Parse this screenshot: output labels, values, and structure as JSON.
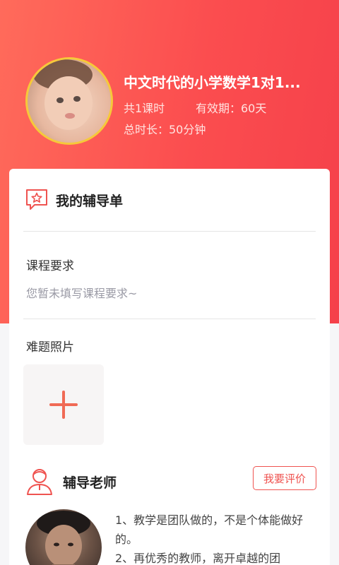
{
  "course": {
    "title": "中文时代的小学数学1对1...",
    "lessons": "共1课时",
    "validity": "有效期：60天",
    "duration": "总时长：50分钟"
  },
  "tutoring_sheet": {
    "title": "我的辅导单",
    "requirement_label": "课程要求",
    "requirement_placeholder": "您暂未填写课程要求~",
    "photos_label": "难题照片"
  },
  "teacher": {
    "title": "辅导老师",
    "rate_button": "我要评价",
    "description": [
      "1、教学是团队做的，不是个体能做好的。",
      "2、再优秀的教师，离开卓越的团"
    ]
  },
  "colors": {
    "accent": "#f5404a",
    "avatar_ring": "#f6c93a"
  },
  "icons": [
    "star-chat-icon",
    "plus-icon",
    "teacher-person-icon"
  ]
}
